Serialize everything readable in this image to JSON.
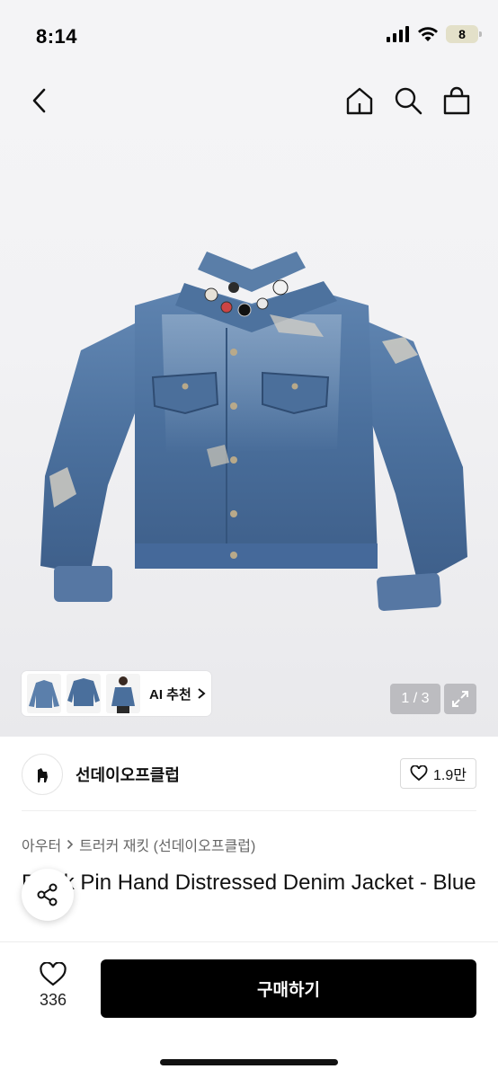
{
  "status_bar": {
    "time": "8:14",
    "battery": "8"
  },
  "gallery": {
    "pager": "1 / 3",
    "ai_label": "AI 추천"
  },
  "seller": {
    "name": "선데이오프클럽",
    "likes": "1.9만"
  },
  "breadcrumb": {
    "category": "아우터",
    "subcategory": "트러커 재킷 (선데이오프클럽)"
  },
  "product": {
    "title": "Black Pin Hand Distressed Denim Jacket - Blue"
  },
  "bottom_bar": {
    "like_count": "336",
    "buy_label": "구매하기"
  },
  "colors": {
    "denim": "#4a6f9c",
    "buy_button": "#000000",
    "background": "#f4f4f6"
  },
  "icons": [
    "back-icon",
    "home-icon",
    "search-icon",
    "bag-icon",
    "expand-icon",
    "heart-icon",
    "share-icon",
    "chevron-right-icon"
  ]
}
